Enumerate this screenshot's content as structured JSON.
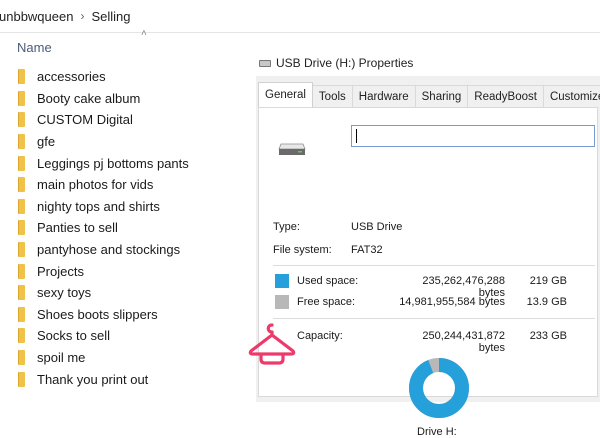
{
  "breadcrumb": {
    "parent": "unbbwqueen",
    "separator": "›",
    "current": "Selling"
  },
  "column_header": "Name",
  "folders": [
    "accessories",
    "Booty cake album",
    "CUSTOM Digital",
    "gfe",
    "Leggings pj bottoms pants",
    "main photos for vids",
    "nighty tops and shirts",
    "Panties to sell",
    "pantyhose and stockings",
    "Projects",
    "sexy toys",
    "Shoes boots slippers",
    "Socks to sell",
    "spoil me",
    "Thank you print out"
  ],
  "dialog": {
    "title": "USB Drive (H:) Properties",
    "tabs": [
      "General",
      "Tools",
      "Hardware",
      "Sharing",
      "ReadyBoost",
      "Customize"
    ],
    "name_value": "",
    "type_label": "Type:",
    "type_value": "USB Drive",
    "fs_label": "File system:",
    "fs_value": "FAT32",
    "used_label": "Used space:",
    "used_bytes": "235,262,476,288 bytes",
    "used_gb": "219 GB",
    "free_label": "Free space:",
    "free_bytes": "14,981,955,584 bytes",
    "free_gb": "13.9 GB",
    "capacity_label": "Capacity:",
    "capacity_bytes": "250,244,431,872 bytes",
    "capacity_gb": "233 GB",
    "drive_label": "Drive H:",
    "used_fraction": 0.94,
    "colors": {
      "used": "#26a0da",
      "free": "#b8b8b8"
    }
  },
  "hanger_color": "#ee3a6a"
}
